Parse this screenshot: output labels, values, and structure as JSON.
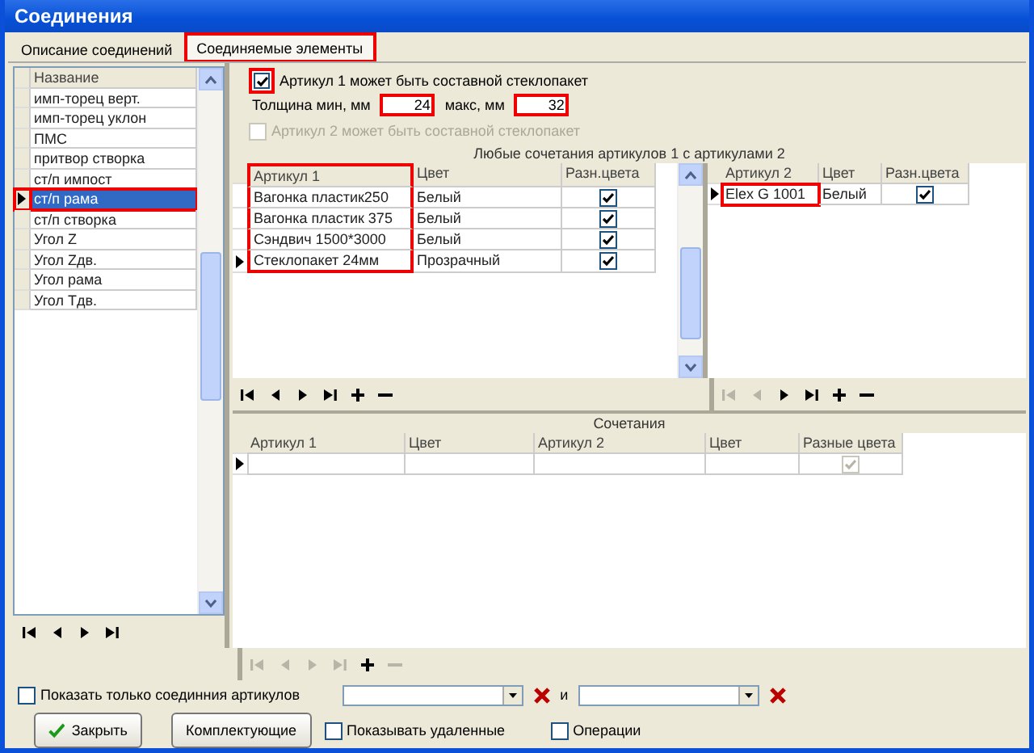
{
  "window": {
    "title": "Соединения"
  },
  "tabs": [
    {
      "label": "Описание соединений",
      "selected": false,
      "highlighted": false
    },
    {
      "label": "Соединяемые элементы",
      "selected": true,
      "highlighted": true
    }
  ],
  "connections_list": {
    "column": "Название",
    "rows": [
      {
        "label": "имп-торец верт.",
        "selected": false,
        "highlighted": false
      },
      {
        "label": "имп-торец уклон",
        "selected": false,
        "highlighted": false
      },
      {
        "label": "ПМС",
        "selected": false,
        "highlighted": false
      },
      {
        "label": "притвор створка",
        "selected": false,
        "highlighted": false
      },
      {
        "label": "ст/п импост",
        "selected": false,
        "highlighted": false
      },
      {
        "label": "ст/п рама",
        "selected": true,
        "highlighted": true
      },
      {
        "label": "ст/п створка",
        "selected": false,
        "highlighted": false
      },
      {
        "label": "Угол Z",
        "selected": false,
        "highlighted": false
      },
      {
        "label": "Угол Zдв.",
        "selected": false,
        "highlighted": false
      },
      {
        "label": "Угол рама",
        "selected": false,
        "highlighted": false
      },
      {
        "label": "Угол Тдв.",
        "selected": false,
        "highlighted": false
      }
    ],
    "nav": [
      {
        "kind": "first",
        "disabled": false
      },
      {
        "kind": "prev",
        "disabled": false
      },
      {
        "kind": "next",
        "disabled": false
      },
      {
        "kind": "last",
        "disabled": false
      }
    ]
  },
  "article1_option": {
    "label": "Артикул 1 может быть составной стеклопакет",
    "checked": true,
    "highlighted": true
  },
  "thickness": {
    "min_label": "Толщина мин, мм",
    "min_value": "24",
    "min_highlighted": true,
    "max_label": "макс, мм",
    "max_value": "32",
    "max_highlighted": true
  },
  "article2_option": {
    "label": "Артикул 2 может быть составной стеклопакет",
    "checked": false,
    "disabled": true
  },
  "any_combinations_caption": "Любые сочетания артикулов 1 с артикулами 2",
  "articles1": {
    "columns": [
      {
        "label": "Артикул 1",
        "highlighted": true
      },
      {
        "label": "Цвет",
        "highlighted": false
      },
      {
        "label": "Разн.цвета",
        "highlighted": false
      }
    ],
    "rows": [
      {
        "cells": [
          "Вагонка пластик250",
          "Белый"
        ],
        "different_colors": true,
        "current": false,
        "highlighted": false
      },
      {
        "cells": [
          "Вагонка пластик 375",
          "Белый"
        ],
        "different_colors": true,
        "current": false,
        "highlighted": false
      },
      {
        "cells": [
          "Сэндвич 1500*3000",
          "Белый"
        ],
        "different_colors": true,
        "current": false,
        "highlighted": false
      },
      {
        "cells": [
          "Стеклопакет 24мм",
          "Прозрачный"
        ],
        "different_colors": true,
        "current": true,
        "highlighted": false
      }
    ],
    "nav": [
      {
        "kind": "first",
        "disabled": false
      },
      {
        "kind": "prev",
        "disabled": false
      },
      {
        "kind": "next",
        "disabled": false
      },
      {
        "kind": "last",
        "disabled": false
      },
      {
        "kind": "add",
        "disabled": false
      },
      {
        "kind": "remove",
        "disabled": false
      }
    ]
  },
  "articles2": {
    "columns": [
      {
        "label": "Артикул 2",
        "highlighted": false
      },
      {
        "label": "Цвет",
        "highlighted": false
      },
      {
        "label": "Разн.цвета",
        "highlighted": false
      }
    ],
    "rows": [
      {
        "cells": [
          "Elex G 1001",
          "Белый"
        ],
        "different_colors": true,
        "current": true,
        "highlighted": true
      }
    ],
    "nav": [
      {
        "kind": "first",
        "disabled": true
      },
      {
        "kind": "prev",
        "disabled": true
      },
      {
        "kind": "next",
        "disabled": false
      },
      {
        "kind": "last",
        "disabled": false
      },
      {
        "kind": "add",
        "disabled": false
      },
      {
        "kind": "remove",
        "disabled": false
      }
    ]
  },
  "combinations": {
    "title": "Сочетания",
    "columns": [
      "Артикул 1",
      "Цвет",
      "Артикул 2",
      "Цвет",
      "Разные цвета"
    ],
    "rows": [
      {
        "different_colors": true,
        "disabled": true,
        "current": true
      }
    ],
    "nav": [
      {
        "kind": "first",
        "disabled": true
      },
      {
        "kind": "prev",
        "disabled": true
      },
      {
        "kind": "next",
        "disabled": true
      },
      {
        "kind": "last",
        "disabled": true
      },
      {
        "kind": "add",
        "disabled": false
      },
      {
        "kind": "remove",
        "disabled": true
      }
    ]
  },
  "filter": {
    "label": "Показать только соединния артикулов",
    "checked": false,
    "joiner": "и"
  },
  "footer": {
    "close_button": "Закрыть",
    "parts_button": "Комплектующие",
    "show_deleted": {
      "label": "Показывать удаленные",
      "checked": false
    },
    "operations": {
      "label": "Операции",
      "checked": false
    }
  }
}
